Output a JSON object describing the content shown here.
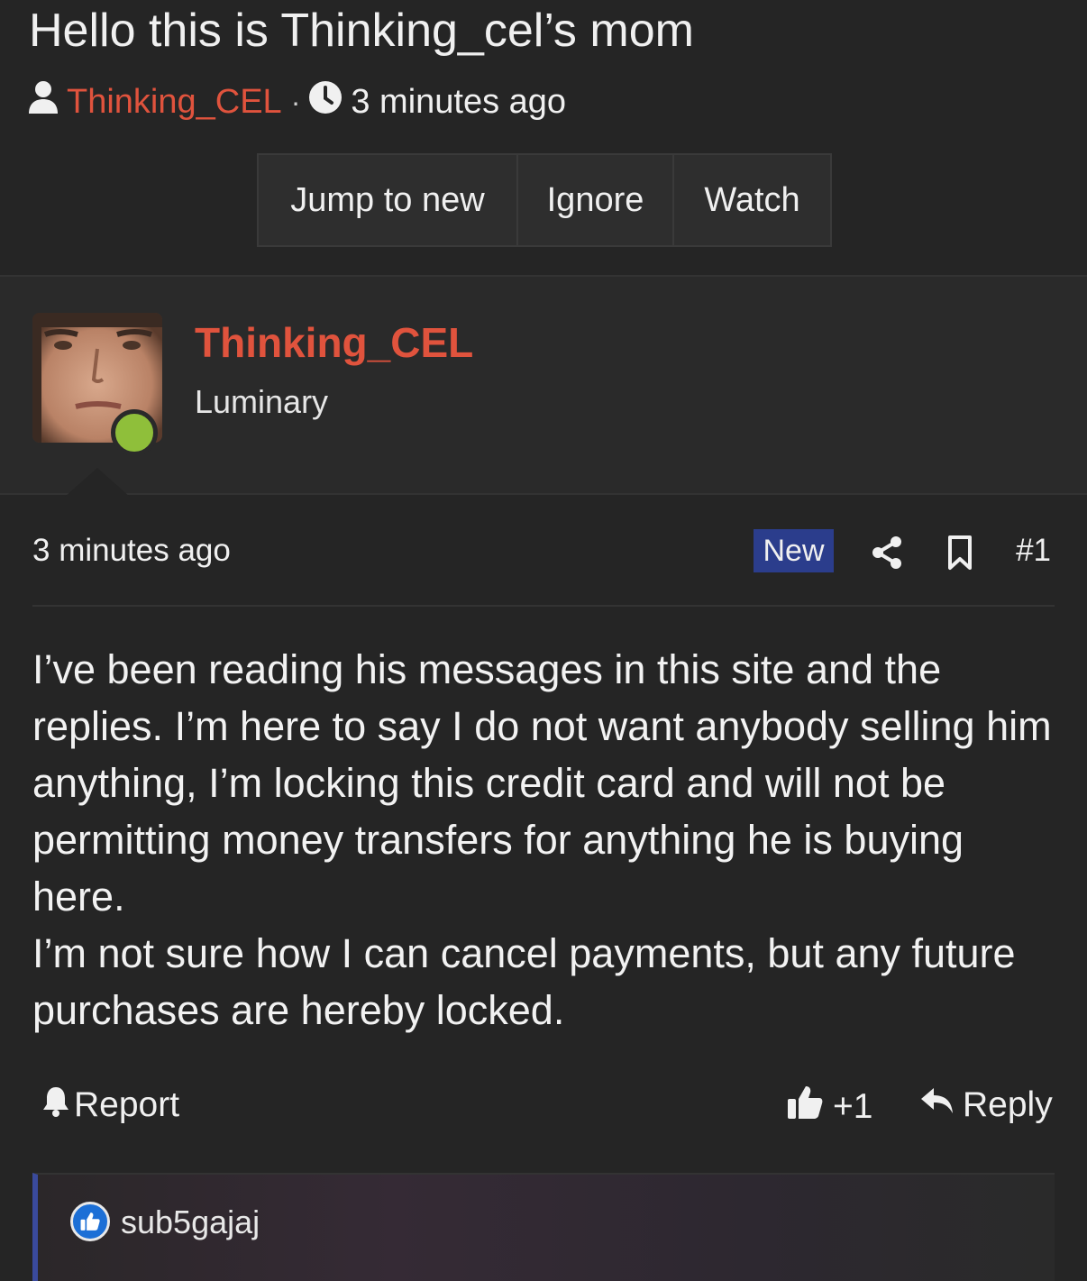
{
  "thread": {
    "title": "Hello this is Thinking_cel’s mom",
    "author": "Thinking_CEL",
    "separator": "·",
    "time": "3 minutes ago"
  },
  "buttons": {
    "jump": "Jump to new",
    "ignore": "Ignore",
    "watch": "Watch"
  },
  "post": {
    "username": "Thinking_CEL",
    "user_title": "Luminary",
    "date": "3 minutes ago",
    "badge": "New",
    "number": "#1",
    "paragraphs": [
      "I’ve been reading his messages in this site and the replies. I’m here to say I do not want anybody selling him anything, I’m locking this credit card and will not be permitting money transfers for anything he is buying here.",
      "I’m not sure how I can cancel payments, but any future purchases are hereby locked."
    ],
    "report_label": "Report",
    "like_count": "+1",
    "reply_label": "Reply",
    "reaction_user": "sub5gajaj"
  },
  "colors": {
    "accent": "#e0533d",
    "online": "#8fbf3a",
    "badge_bg": "#2b3d8c",
    "background": "#252525"
  },
  "icons": [
    "user-icon",
    "clock-icon",
    "share-icon",
    "bookmark-icon",
    "bell-icon",
    "thumbs-up-icon",
    "reply-icon"
  ]
}
